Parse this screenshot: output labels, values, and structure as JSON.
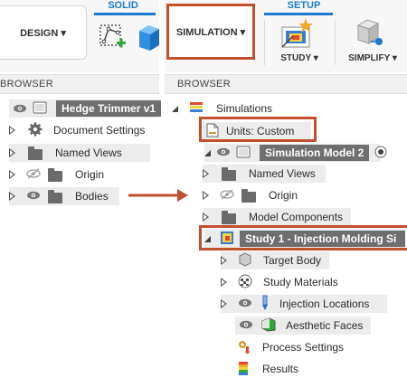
{
  "left": {
    "toolbar": {
      "workspace_label": "DESIGN ▾",
      "tab_label": "SOLID"
    },
    "browser_label": "BROWSER",
    "tree": {
      "root_label": "Hedge Trimmer v1",
      "items": [
        {
          "label": "Document Settings",
          "icon": "gear-icon"
        },
        {
          "label": "Named Views",
          "icon": "folder-icon"
        },
        {
          "label": "Origin",
          "icon": "folder-icon"
        },
        {
          "label": "Bodies",
          "icon": "folder-icon"
        }
      ]
    }
  },
  "right": {
    "toolbar": {
      "workspace_label": "SIMULATION ▾",
      "tab_label": "SETUP",
      "study_label": "STUDY ▾",
      "simplify_label": "SIMPLIFY ▾"
    },
    "browser_label": "BROWSER",
    "tree": {
      "root_label": "Simulations",
      "units_label": "Units: Custom",
      "model_label": "Simulation Model 2",
      "model_items": [
        {
          "label": "Named Views",
          "icon": "folder-icon"
        },
        {
          "label": "Origin",
          "icon": "folder-icon"
        },
        {
          "label": "Model Components",
          "icon": "folder-icon"
        }
      ],
      "study_label": "Study 1 - Injection Molding Si",
      "study_items": [
        {
          "label": "Target Body",
          "icon": "body-icon"
        },
        {
          "label": "Study Materials",
          "icon": "materials-icon"
        },
        {
          "label": "Injection Locations",
          "icon": "injection-icon"
        },
        {
          "label": "Aesthetic Faces",
          "icon": "aesthetic-faces-icon"
        },
        {
          "label": "Process Settings",
          "icon": "process-settings-icon"
        },
        {
          "label": "Results",
          "icon": "results-icon"
        }
      ]
    }
  },
  "colors": {
    "highlight": "#c2502f",
    "accent": "#1a7ad1"
  }
}
